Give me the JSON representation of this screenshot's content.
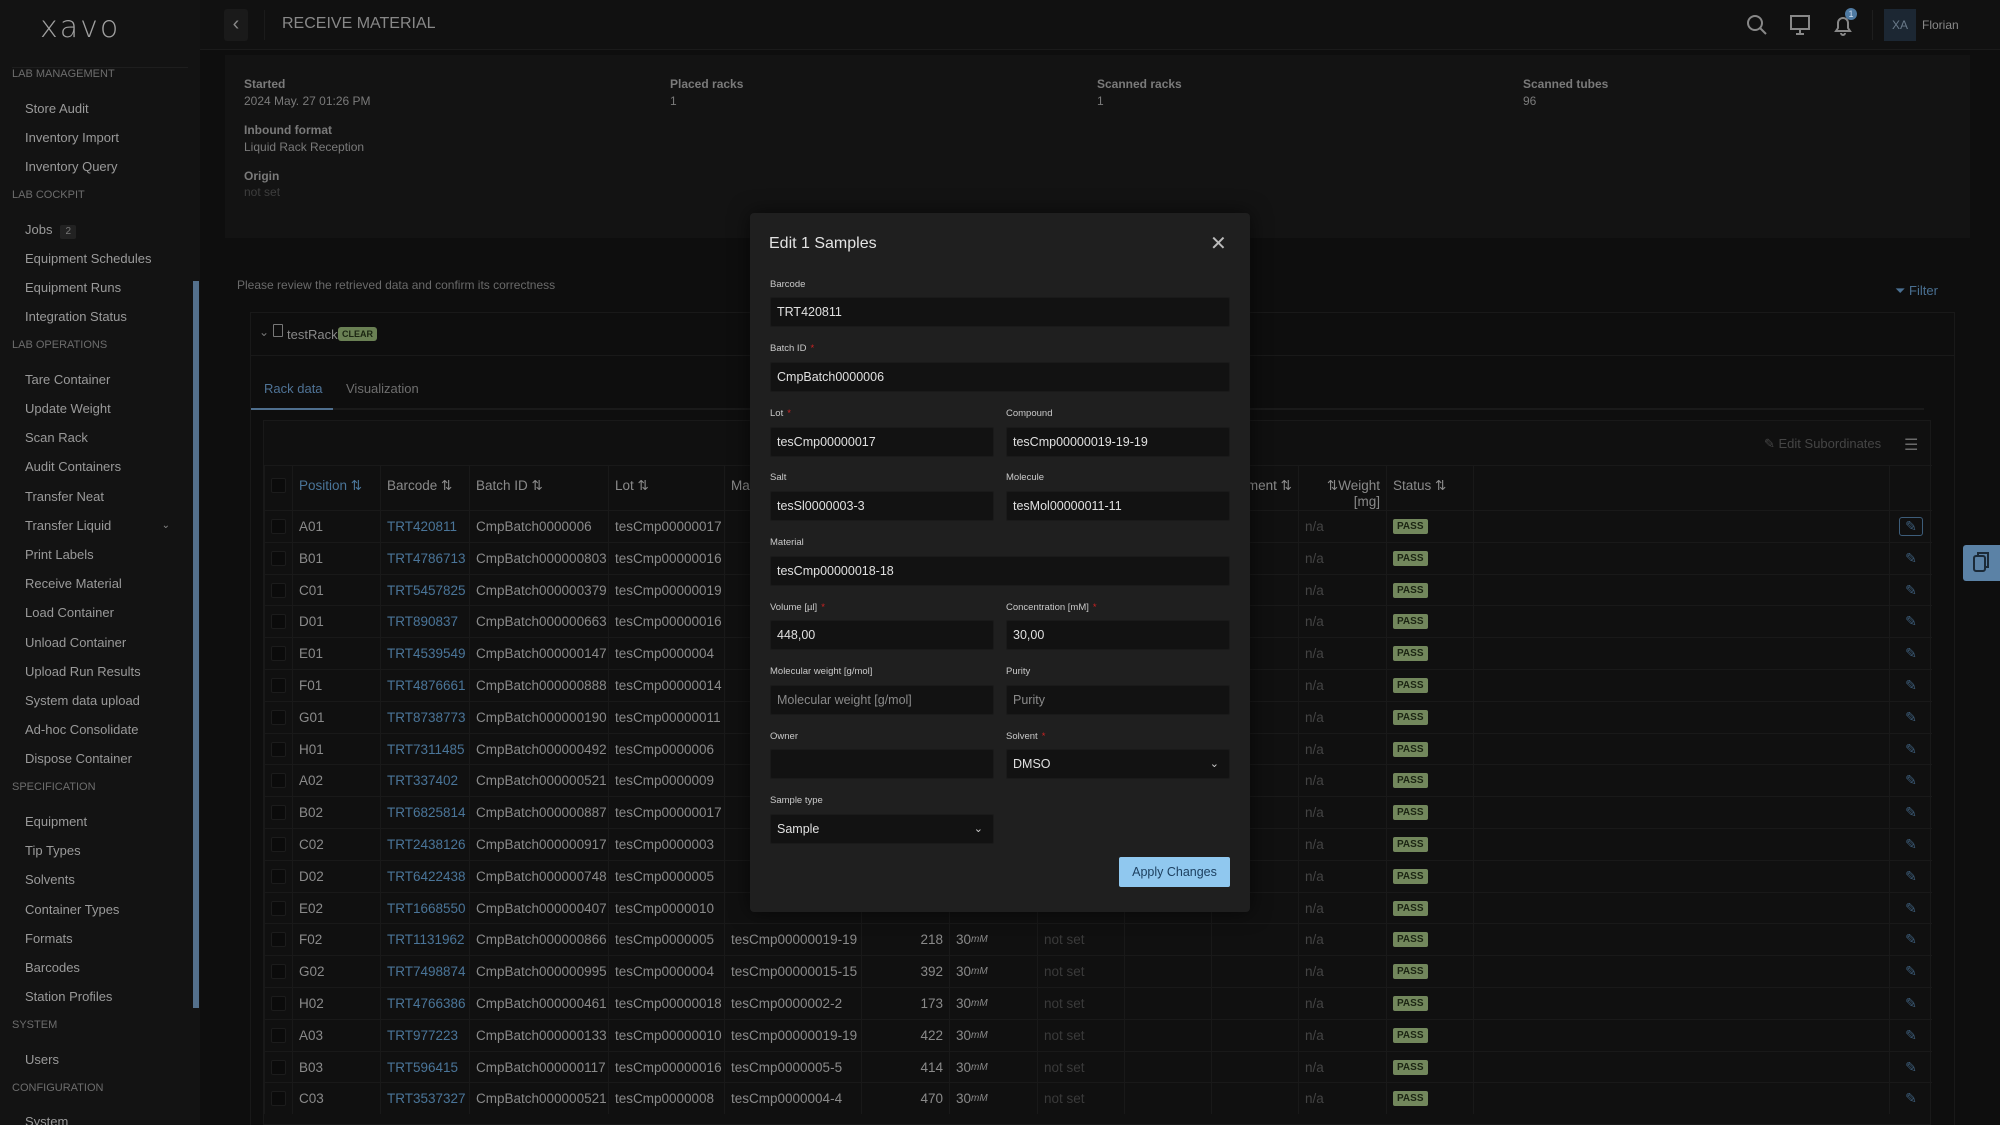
{
  "app": {
    "logo": "xavo",
    "page_title": "RECEIVE MATERIAL",
    "user_initials": "XA",
    "user_name": "Florian",
    "notification_count": "1"
  },
  "sidebar": {
    "sections": [
      {
        "label": "LAB MANAGEMENT",
        "items": [
          {
            "label": "Store Audit"
          },
          {
            "label": "Inventory Import"
          },
          {
            "label": "Inventory Query"
          }
        ]
      },
      {
        "label": "LAB COCKPIT",
        "items": [
          {
            "label": "Jobs",
            "badge": "2"
          },
          {
            "label": "Equipment Schedules"
          },
          {
            "label": "Equipment Runs"
          },
          {
            "label": "Integration Status"
          }
        ]
      },
      {
        "label": "LAB OPERATIONS",
        "items": [
          {
            "label": "Tare Container"
          },
          {
            "label": "Update Weight"
          },
          {
            "label": "Scan Rack"
          },
          {
            "label": "Audit Containers"
          },
          {
            "label": "Transfer Neat"
          },
          {
            "label": "Transfer Liquid",
            "expandable": true
          },
          {
            "label": "Print Labels"
          },
          {
            "label": "Receive Material"
          },
          {
            "label": "Load Container"
          },
          {
            "label": "Unload Container"
          },
          {
            "label": "Upload Run Results"
          },
          {
            "label": "System data upload"
          },
          {
            "label": "Ad-hoc Consolidate"
          },
          {
            "label": "Dispose Container"
          }
        ]
      },
      {
        "label": "SPECIFICATION",
        "items": [
          {
            "label": "Equipment"
          },
          {
            "label": "Tip Types"
          },
          {
            "label": "Solvents"
          },
          {
            "label": "Container Types"
          },
          {
            "label": "Formats"
          },
          {
            "label": "Barcodes"
          },
          {
            "label": "Station Profiles"
          }
        ]
      },
      {
        "label": "SYSTEM",
        "items": [
          {
            "label": "Users"
          }
        ]
      },
      {
        "label": "CONFIGURATION",
        "items": [
          {
            "label": "System"
          }
        ]
      }
    ]
  },
  "info": {
    "started_label": "Started",
    "started": "2024 May. 27 01:26 PM",
    "inbound_label": "Inbound format",
    "inbound": "Liquid Rack Reception",
    "origin_label": "Origin",
    "origin": "not set",
    "placed_label": "Placed racks",
    "placed": "1",
    "scanned_racks_label": "Scanned racks",
    "scanned_racks": "1",
    "scanned_tubes_label": "Scanned tubes",
    "scanned_tubes": "96"
  },
  "review_text": "Please review the retrieved data and confirm its correctness",
  "filter_label": "Filter",
  "rack": {
    "name": "testRack",
    "status": "CLEAR",
    "tabs": [
      "Rack data",
      "Visualization"
    ],
    "edit_subordinates": "Edit Subordinates"
  },
  "table": {
    "headers": {
      "position": "Position",
      "barcode": "Barcode",
      "batch": "Batch ID",
      "lot": "Lot",
      "material": "Material",
      "hidden": "ment",
      "weight": "Weight [mg]",
      "status": "Status"
    },
    "rows": [
      {
        "pos": "A01",
        "barcode": "TRT420811",
        "batch": "CmpBatch0000006",
        "lot": "tesCmp00000017",
        "weight": "n/a",
        "status": "PASS"
      },
      {
        "pos": "B01",
        "barcode": "TRT4786713",
        "batch": "CmpBatch000000803",
        "lot": "tesCmp00000016",
        "weight": "n/a",
        "status": "PASS"
      },
      {
        "pos": "C01",
        "barcode": "TRT5457825",
        "batch": "CmpBatch000000379",
        "lot": "tesCmp00000019",
        "weight": "n/a",
        "status": "PASS"
      },
      {
        "pos": "D01",
        "barcode": "TRT890837",
        "batch": "CmpBatch000000663",
        "lot": "tesCmp00000016",
        "weight": "n/a",
        "status": "PASS"
      },
      {
        "pos": "E01",
        "barcode": "TRT4539549",
        "batch": "CmpBatch000000147",
        "lot": "tesCmp0000004",
        "weight": "n/a",
        "status": "PASS"
      },
      {
        "pos": "F01",
        "barcode": "TRT4876661",
        "batch": "CmpBatch000000888",
        "lot": "tesCmp00000014",
        "weight": "n/a",
        "status": "PASS"
      },
      {
        "pos": "G01",
        "barcode": "TRT8738773",
        "batch": "CmpBatch000000190",
        "lot": "tesCmp00000011",
        "weight": "n/a",
        "status": "PASS"
      },
      {
        "pos": "H01",
        "barcode": "TRT7311485",
        "batch": "CmpBatch000000492",
        "lot": "tesCmp0000006",
        "weight": "n/a",
        "status": "PASS"
      },
      {
        "pos": "A02",
        "barcode": "TRT337402",
        "batch": "CmpBatch000000521",
        "lot": "tesCmp0000009",
        "weight": "n/a",
        "status": "PASS"
      },
      {
        "pos": "B02",
        "barcode": "TRT6825814",
        "batch": "CmpBatch000000887",
        "lot": "tesCmp00000017",
        "weight": "n/a",
        "status": "PASS"
      },
      {
        "pos": "C02",
        "barcode": "TRT2438126",
        "batch": "CmpBatch000000917",
        "lot": "tesCmp0000003",
        "weight": "n/a",
        "status": "PASS"
      },
      {
        "pos": "D02",
        "barcode": "TRT6422438",
        "batch": "CmpBatch000000748",
        "lot": "tesCmp0000005",
        "weight": "n/a",
        "status": "PASS"
      },
      {
        "pos": "E02",
        "barcode": "TRT1668550",
        "batch": "CmpBatch000000407",
        "lot": "tesCmp0000010",
        "weight": "n/a",
        "status": "PASS"
      },
      {
        "pos": "F02",
        "barcode": "TRT1131962",
        "batch": "CmpBatch000000866",
        "lot": "tesCmp0000005",
        "material": "tesCmp00000019-19",
        "volume": "218",
        "conc": "30",
        "conc_unit": "mM",
        "extra": "not set",
        "weight": "n/a",
        "status": "PASS"
      },
      {
        "pos": "G02",
        "barcode": "TRT7498874",
        "batch": "CmpBatch000000995",
        "lot": "tesCmp0000004",
        "material": "tesCmp00000015-15",
        "volume": "392",
        "conc": "30",
        "conc_unit": "mM",
        "extra": "not set",
        "weight": "n/a",
        "status": "PASS"
      },
      {
        "pos": "H02",
        "barcode": "TRT4766386",
        "batch": "CmpBatch000000461",
        "lot": "tesCmp00000018",
        "material": "tesCmp0000002-2",
        "volume": "173",
        "conc": "30",
        "conc_unit": "mM",
        "extra": "not set",
        "weight": "n/a",
        "status": "PASS"
      },
      {
        "pos": "A03",
        "barcode": "TRT977223",
        "batch": "CmpBatch000000133",
        "lot": "tesCmp00000010",
        "material": "tesCmp00000019-19",
        "volume": "422",
        "conc": "30",
        "conc_unit": "mM",
        "extra": "not set",
        "weight": "n/a",
        "status": "PASS"
      },
      {
        "pos": "B03",
        "barcode": "TRT596415",
        "batch": "CmpBatch000000117",
        "lot": "tesCmp00000016",
        "material": "tesCmp0000005-5",
        "volume": "414",
        "conc": "30",
        "conc_unit": "mM",
        "extra": "not set",
        "weight": "n/a",
        "status": "PASS"
      },
      {
        "pos": "C03",
        "barcode": "TRT3537327",
        "batch": "CmpBatch000000521",
        "lot": "tesCmp0000008",
        "material": "tesCmp0000004-4",
        "volume": "470",
        "conc": "30",
        "conc_unit": "mM",
        "extra": "not set",
        "weight": "n/a",
        "status": "PASS"
      }
    ]
  },
  "modal": {
    "title": "Edit 1 Samples",
    "required_mark": "*",
    "barcode": {
      "label": "Barcode",
      "value": "TRT420811"
    },
    "batch": {
      "label": "Batch ID",
      "value": "CmpBatch0000006"
    },
    "lot": {
      "label": "Lot",
      "value": "tesCmp00000017"
    },
    "compound": {
      "label": "Compound",
      "value": "tesCmp00000019-19-19"
    },
    "salt": {
      "label": "Salt",
      "value": "tesSl0000003-3"
    },
    "molecule": {
      "label": "Molecule",
      "value": "tesMol00000011-11"
    },
    "material": {
      "label": "Material",
      "value": "tesCmp00000018-18"
    },
    "volume": {
      "label": "Volume [µl]",
      "value": "448,00"
    },
    "concentration": {
      "label": "Concentration [mM]",
      "value": "30,00"
    },
    "mw": {
      "label": "Molecular weight [g/mol]",
      "placeholder": "Molecular weight [g/mol]"
    },
    "purity": {
      "label": "Purity",
      "placeholder": "Purity"
    },
    "owner": {
      "label": "Owner",
      "value": ""
    },
    "solvent": {
      "label": "Solvent",
      "value": "DMSO"
    },
    "sample_type": {
      "label": "Sample type",
      "value": "Sample"
    },
    "apply": "Apply Changes"
  },
  "colors": {
    "accent": "#4a7599",
    "pass": "#72875c",
    "apply": "#90c8ef",
    "required": "#cc2222"
  }
}
